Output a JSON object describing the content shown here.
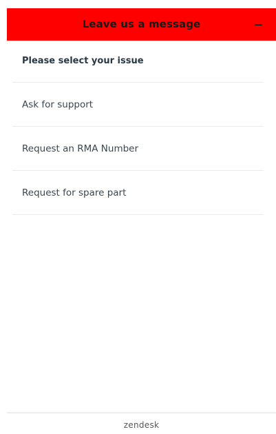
{
  "header": {
    "title": "Leave us a message",
    "minimize_icon": "minus-icon",
    "background_color": "#ff0000"
  },
  "issue_list": {
    "heading": "Please select your issue",
    "items": [
      {
        "label": "Ask for support"
      },
      {
        "label": "Request an RMA Number"
      },
      {
        "label": "Request for spare part"
      }
    ]
  },
  "footer": {
    "brand": "zendesk"
  }
}
